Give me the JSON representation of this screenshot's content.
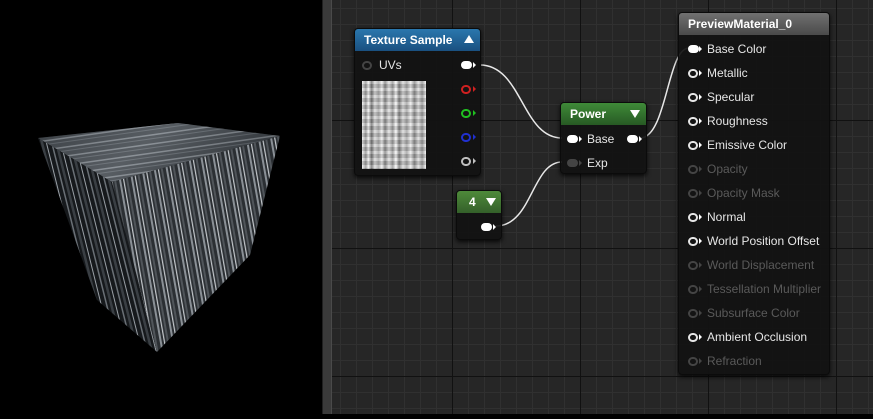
{
  "viewport": {
    "preview_object": "textured-cube"
  },
  "nodes": {
    "texture_sample": {
      "title": "Texture Sample",
      "header_color": "#1a5a86",
      "uv_label": "UVs",
      "output_colors": [
        "#ffffff",
        "#d02020",
        "#20c020",
        "#2030d0",
        "#c0c0c0"
      ]
    },
    "power": {
      "title": "Power",
      "header_color": "#2f6a2a",
      "base_label": "Base",
      "exp_label": "Exp"
    },
    "constant": {
      "value": "4",
      "header_color": "#3c6a2a"
    },
    "preview_material": {
      "title": "PreviewMaterial_0",
      "header_color": "#5a5a5a",
      "pins": [
        {
          "label": "Base Color",
          "enabled": true,
          "connected": true
        },
        {
          "label": "Metallic",
          "enabled": true,
          "connected": false
        },
        {
          "label": "Specular",
          "enabled": true,
          "connected": false
        },
        {
          "label": "Roughness",
          "enabled": true,
          "connected": false
        },
        {
          "label": "Emissive Color",
          "enabled": true,
          "connected": false
        },
        {
          "label": "Opacity",
          "enabled": false,
          "connected": false
        },
        {
          "label": "Opacity Mask",
          "enabled": false,
          "connected": false
        },
        {
          "label": "Normal",
          "enabled": true,
          "connected": false
        },
        {
          "label": "World Position Offset",
          "enabled": true,
          "connected": false
        },
        {
          "label": "World Displacement",
          "enabled": false,
          "connected": false
        },
        {
          "label": "Tessellation Multiplier",
          "enabled": false,
          "connected": false
        },
        {
          "label": "Subsurface Color",
          "enabled": false,
          "connected": false
        },
        {
          "label": "Ambient Occlusion",
          "enabled": true,
          "connected": false
        },
        {
          "label": "Refraction",
          "enabled": false,
          "connected": false
        }
      ]
    }
  }
}
